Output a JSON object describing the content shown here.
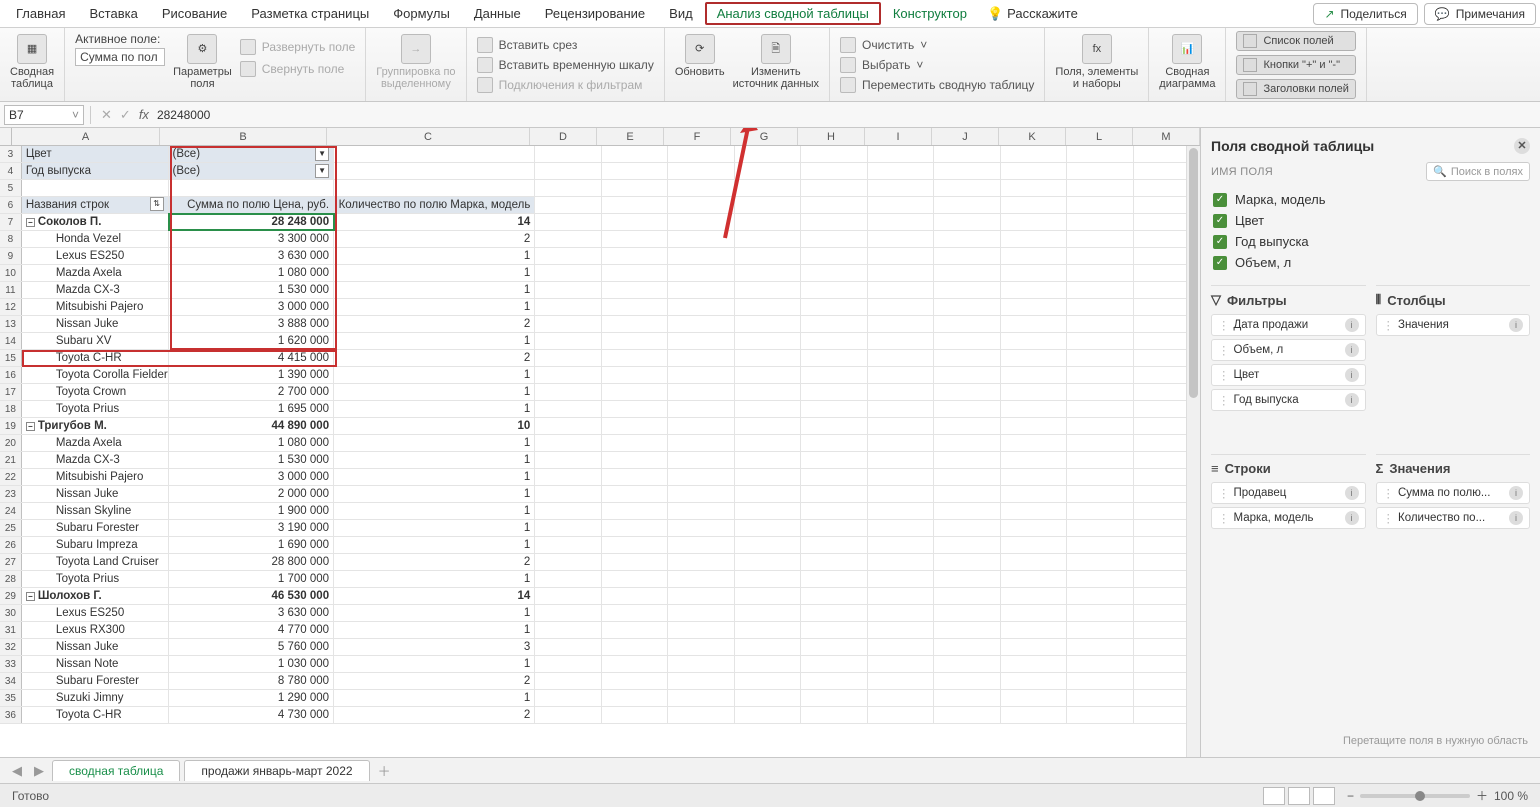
{
  "tabs": [
    "Главная",
    "Вставка",
    "Рисование",
    "Разметка страницы",
    "Формулы",
    "Данные",
    "Рецензирование",
    "Вид",
    "Анализ сводной таблицы",
    "Конструктор"
  ],
  "tell": "Расскажите",
  "share": "Поделиться",
  "comments": "Примечания",
  "ribbon": {
    "pivot": "Сводная\nтаблица",
    "activeField": "Активное поле:",
    "activeValue": "Сумма по пол",
    "fieldSettings": "Параметры\nполя",
    "expand": "Развернуть поле",
    "collapse": "Свернуть поле",
    "groupSel": "Группировка по\nвыделенному",
    "slicer": "Вставить срез",
    "timeline": "Вставить временную шкалу",
    "filterConn": "Подключения к фильтрам",
    "refresh": "Обновить",
    "changeSrc": "Изменить\nисточник данных",
    "clear": "Очистить",
    "select": "Выбрать",
    "move": "Переместить сводную таблицу",
    "fields": "Поля, элементы\nи наборы",
    "chart": "Сводная\nдиаграмма",
    "fieldList": "Список полей",
    "pmButtons": "Кнопки \"+\" и \"-\"",
    "fieldHdrs": "Заголовки полей"
  },
  "nameBox": "B7",
  "formula": "28248000",
  "cols": [
    "A",
    "B",
    "C",
    "D",
    "E",
    "F",
    "G",
    "H",
    "I",
    "J",
    "K",
    "L",
    "M"
  ],
  "filters": [
    {
      "r": 3,
      "label": "Цвет",
      "val": "(Все)"
    },
    {
      "r": 4,
      "label": "Год выпуска",
      "val": "(Все)"
    }
  ],
  "headers": {
    "r": 6,
    "a": "Названия строк",
    "b": "Сумма по полю Цена, руб.",
    "c": "Количество по полю Марка, модель"
  },
  "rows": [
    {
      "r": 7,
      "a": "Соколов П.",
      "b": "28 248 000",
      "c": "14",
      "g": true,
      "sel": true
    },
    {
      "r": 8,
      "a": "Honda Vezel",
      "b": "3 300 000",
      "c": "2"
    },
    {
      "r": 9,
      "a": "Lexus ES250",
      "b": "3 630 000",
      "c": "1"
    },
    {
      "r": 10,
      "a": "Mazda Axela",
      "b": "1 080 000",
      "c": "1"
    },
    {
      "r": 11,
      "a": "Mazda CX-3",
      "b": "1 530 000",
      "c": "1"
    },
    {
      "r": 12,
      "a": "Mitsubishi Pajero",
      "b": "3 000 000",
      "c": "1"
    },
    {
      "r": 13,
      "a": "Nissan Juke",
      "b": "3 888 000",
      "c": "2"
    },
    {
      "r": 14,
      "a": "Subaru XV",
      "b": "1 620 000",
      "c": "1"
    },
    {
      "r": 15,
      "a": "Toyota C-HR",
      "b": "4 415 000",
      "c": "2"
    },
    {
      "r": 16,
      "a": "Toyota Corolla Fielder",
      "b": "1 390 000",
      "c": "1"
    },
    {
      "r": 17,
      "a": "Toyota Crown",
      "b": "2 700 000",
      "c": "1"
    },
    {
      "r": 18,
      "a": "Toyota Prius",
      "b": "1 695 000",
      "c": "1"
    },
    {
      "r": 19,
      "a": "Тригубов М.",
      "b": "44 890 000",
      "c": "10",
      "g": true
    },
    {
      "r": 20,
      "a": "Mazda Axela",
      "b": "1 080 000",
      "c": "1"
    },
    {
      "r": 21,
      "a": "Mazda CX-3",
      "b": "1 530 000",
      "c": "1"
    },
    {
      "r": 22,
      "a": "Mitsubishi Pajero",
      "b": "3 000 000",
      "c": "1"
    },
    {
      "r": 23,
      "a": "Nissan Juke",
      "b": "2 000 000",
      "c": "1"
    },
    {
      "r": 24,
      "a": "Nissan Skyline",
      "b": "1 900 000",
      "c": "1"
    },
    {
      "r": 25,
      "a": "Subaru Forester",
      "b": "3 190 000",
      "c": "1"
    },
    {
      "r": 26,
      "a": "Subaru Impreza",
      "b": "1 690 000",
      "c": "1"
    },
    {
      "r": 27,
      "a": "Toyota Land Cruiser",
      "b": "28 800 000",
      "c": "2"
    },
    {
      "r": 28,
      "a": "Toyota Prius",
      "b": "1 700 000",
      "c": "1"
    },
    {
      "r": 29,
      "a": "Шолохов Г.",
      "b": "46 530 000",
      "c": "14",
      "g": true
    },
    {
      "r": 30,
      "a": "Lexus ES250",
      "b": "3 630 000",
      "c": "1"
    },
    {
      "r": 31,
      "a": "Lexus RX300",
      "b": "4 770 000",
      "c": "1"
    },
    {
      "r": 32,
      "a": "Nissan Juke",
      "b": "5 760 000",
      "c": "3"
    },
    {
      "r": 33,
      "a": "Nissan Note",
      "b": "1 030 000",
      "c": "1"
    },
    {
      "r": 34,
      "a": "Subaru Forester",
      "b": "8 780 000",
      "c": "2"
    },
    {
      "r": 35,
      "a": "Suzuki Jimny",
      "b": "1 290 000",
      "c": "1"
    },
    {
      "r": 36,
      "a": "Toyota C-HR",
      "b": "4 730 000",
      "c": "2"
    }
  ],
  "panel": {
    "title": "Поля сводной таблицы",
    "sub": "ИМЯ ПОЛЯ",
    "search": "Поиск в полях",
    "fields": [
      "Марка, модель",
      "Цвет",
      "Год выпуска",
      "Объем, л"
    ],
    "areaFilters": "Фильтры",
    "areaCols": "Столбцы",
    "areaRows": "Строки",
    "areaVals": "Значения",
    "filters": [
      "Дата продажи",
      "Объем, л",
      "Цвет",
      "Год выпуска"
    ],
    "cols": [
      "Значения"
    ],
    "rowsA": [
      "Продавец",
      "Марка, модель"
    ],
    "vals": [
      "Сумма по полю...",
      "Количество по..."
    ],
    "foot": "Перетащите поля в нужную область"
  },
  "sheets": {
    "active": "сводная таблица",
    "other": "продажи январь-март 2022"
  },
  "status": "Готово",
  "zoom": "100 %"
}
